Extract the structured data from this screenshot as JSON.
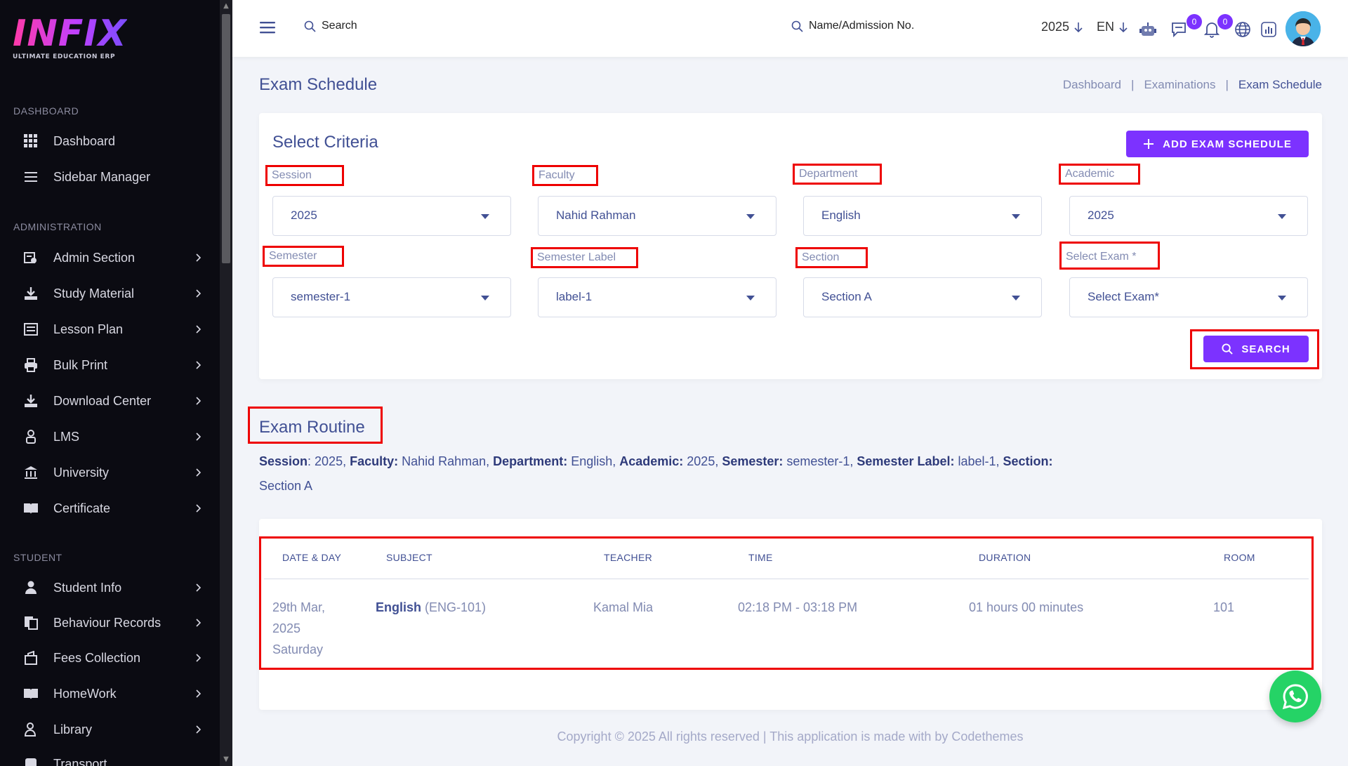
{
  "brand": {
    "logo_text": "INFIX",
    "tagline": "ULTIMATE EDUCATION ERP"
  },
  "sidebar": {
    "sections": [
      {
        "title": "DASHBOARD"
      },
      {
        "title": "ADMINISTRATION"
      },
      {
        "title": "STUDENT"
      }
    ],
    "items": [
      {
        "label": "Dashboard",
        "icon": "grid-icon"
      },
      {
        "label": "Sidebar Manager",
        "icon": "menu-lines-icon"
      },
      {
        "label": "Admin Section",
        "icon": "admin-icon"
      },
      {
        "label": "Study Material",
        "icon": "download-icon"
      },
      {
        "label": "Lesson Plan",
        "icon": "lesson-icon"
      },
      {
        "label": "Bulk Print",
        "icon": "printer-icon"
      },
      {
        "label": "Download Center",
        "icon": "download-icon"
      },
      {
        "label": "LMS",
        "icon": "lms-icon"
      },
      {
        "label": "University",
        "icon": "university-icon"
      },
      {
        "label": "Certificate",
        "icon": "book-icon"
      },
      {
        "label": "Student Info",
        "icon": "user-icon"
      },
      {
        "label": "Behaviour Records",
        "icon": "records-icon"
      },
      {
        "label": "Fees Collection",
        "icon": "fees-icon"
      },
      {
        "label": "HomeWork",
        "icon": "book-icon"
      },
      {
        "label": "Library",
        "icon": "library-icon"
      },
      {
        "label": "Transport",
        "icon": "transport-icon"
      }
    ]
  },
  "topbar": {
    "search_label": "Search",
    "student_search_label": "Name/Admission No.",
    "year": "2025",
    "language": "EN",
    "chat_count": "0",
    "notification_count": "0"
  },
  "page": {
    "title": "Exam Schedule",
    "breadcrumb": [
      "Dashboard",
      "Examinations",
      "Exam Schedule"
    ]
  },
  "criteria": {
    "title": "Select Criteria",
    "add_button": "ADD EXAM SCHEDULE",
    "search_button": "SEARCH",
    "fields": [
      {
        "label": "Session",
        "value": "2025"
      },
      {
        "label": "Faculty",
        "value": "Nahid Rahman"
      },
      {
        "label": "Department",
        "value": "English"
      },
      {
        "label": "Academic",
        "value": "2025"
      },
      {
        "label": "Semester",
        "value": "semester-1"
      },
      {
        "label": "Semester Label",
        "value": "label-1"
      },
      {
        "label": "Section",
        "value": "Section A"
      },
      {
        "label": "Select Exam *",
        "value": "Select Exam*"
      }
    ]
  },
  "routine": {
    "title": "Exam Routine",
    "info": [
      {
        "key": "Session",
        "value": ": 2025, "
      },
      {
        "key": "Faculty:",
        "value": " Nahid Rahman, "
      },
      {
        "key": "Department:",
        "value": " English, "
      },
      {
        "key": "Academic:",
        "value": " 2025, "
      },
      {
        "key": "Semester:",
        "value": " semester-1, "
      },
      {
        "key": "Semester Label:",
        "value": " label-1, "
      },
      {
        "key": "Section:",
        "value": " Section A"
      }
    ],
    "columns": [
      "DATE & DAY",
      "SUBJECT",
      "TEACHER",
      "TIME",
      "DURATION",
      "ROOM"
    ],
    "rows": [
      {
        "date": "29th Mar,",
        "year": "2025",
        "day": "Saturday",
        "subject": "English",
        "subject_code": " (ENG-101)",
        "teacher": "Kamal Mia",
        "time": "02:18 PM - 03:18 PM",
        "duration": "01 hours 00 minutes",
        "room": "101"
      }
    ]
  },
  "footer": {
    "text": "Copyright © 2025 All rights reserved | This application is made with by Codethemes"
  },
  "colors": {
    "primary": "#7c32ff",
    "text": "#415094",
    "muted": "#828bb2",
    "sidebar": "#0b0b12",
    "highlight": "#ee0000",
    "whatsapp": "#25d366"
  }
}
